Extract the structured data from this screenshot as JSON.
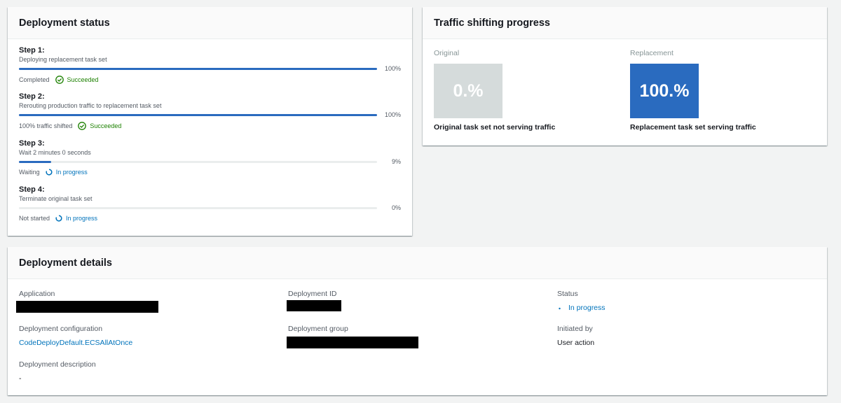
{
  "deployment_status": {
    "title": "Deployment status",
    "steps": [
      {
        "title": "Step 1:",
        "description": "Deploying replacement task set",
        "percent_label": "100%",
        "progress": 100,
        "status_text": "Completed",
        "state_label": "Succeeded",
        "state": "success"
      },
      {
        "title": "Step 2:",
        "description": "Rerouting production traffic to replacement task set",
        "percent_label": "100%",
        "progress": 100,
        "status_text": "100% traffic shifted",
        "state_label": "Succeeded",
        "state": "success"
      },
      {
        "title": "Step 3:",
        "description": "Wait 2 minutes 0 seconds",
        "percent_label": "9%",
        "progress": 9,
        "status_text": "Waiting",
        "state_label": "In progress",
        "state": "in-progress"
      },
      {
        "title": "Step 4:",
        "description": "Terminate original task set",
        "percent_label": "0%",
        "progress": 0,
        "status_text": "Not started",
        "state_label": "In progress",
        "state": "in-progress"
      }
    ]
  },
  "traffic_shifting": {
    "title": "Traffic shifting progress",
    "original": {
      "label": "Original",
      "value": "0.%",
      "caption": "Original task set not serving traffic",
      "color": "#d5dbdb"
    },
    "replacement": {
      "label": "Replacement",
      "value": "100.%",
      "caption": "Replacement task set serving traffic",
      "color": "#2a6bbf"
    }
  },
  "deployment_details": {
    "title": "Deployment details",
    "application": {
      "label": "Application",
      "value_redacted": true
    },
    "deployment_id": {
      "label": "Deployment ID",
      "value_redacted": true
    },
    "status": {
      "label": "Status",
      "value": "In progress"
    },
    "configuration": {
      "label": "Deployment configuration",
      "value": "CodeDeployDefault.ECSAllAtOnce"
    },
    "group": {
      "label": "Deployment group",
      "value_redacted": true
    },
    "initiated_by": {
      "label": "Initiated by",
      "value": "User action"
    },
    "description": {
      "label": "Deployment description",
      "value": "-"
    }
  },
  "colors": {
    "accent": "#0073bb",
    "success": "#1d8102",
    "progress_bar": "#2a6bbf"
  }
}
